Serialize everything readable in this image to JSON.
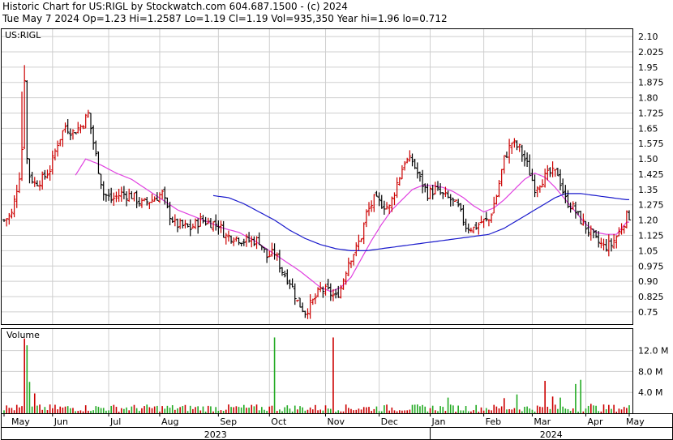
{
  "header": {
    "line1": "Historic Chart for US:RIGL by Stockwatch.com 604.687.1500 - (c) 2024",
    "line2": "Tue May  7 2024   Op=1.23  Hi=1.2587  Lo=1.19  Cl=1.19  Vol=935,350  Year hi=1.96  lo=0.712"
  },
  "chart_data": {
    "type": "candlestick",
    "symbol_label": "US:RIGL",
    "price_axis": {
      "ticks": [
        "2.10",
        "2.025",
        "1.95",
        "1.875",
        "1.80",
        "1.725",
        "1.65",
        "1.575",
        "1.50",
        "1.425",
        "1.35",
        "1.275",
        "1.20",
        "1.125",
        "1.05",
        "0.975",
        "0.90",
        "0.825",
        "0.75"
      ],
      "tick_values": [
        2.1,
        2.025,
        1.95,
        1.875,
        1.8,
        1.725,
        1.65,
        1.575,
        1.5,
        1.425,
        1.35,
        1.275,
        1.2,
        1.125,
        1.05,
        0.975,
        0.9,
        0.825,
        0.75
      ],
      "range": [
        0.69,
        2.14
      ]
    },
    "volume_panel": {
      "label": "Volume",
      "ticks": [
        "12.0 M",
        "8.0 M",
        "4.0 M"
      ],
      "tick_values": [
        12.0,
        8.0,
        4.0
      ],
      "range": [
        0,
        15.5
      ]
    },
    "x_axis": {
      "months": [
        "May",
        "Jun",
        "Jul",
        "Aug",
        "Sep",
        "Oct",
        "Nov",
        "Dec",
        "Jan",
        "Feb",
        "Mar",
        "Apr",
        "May"
      ],
      "years": [
        "2023",
        "2024"
      ]
    },
    "price_anchors": [
      [
        0,
        1.2
      ],
      [
        3,
        1.23
      ],
      [
        6,
        1.42
      ],
      [
        7,
        1.55
      ],
      [
        8,
        1.9
      ],
      [
        9,
        1.5
      ],
      [
        10,
        1.42
      ],
      [
        12,
        1.38
      ],
      [
        15,
        1.4
      ],
      [
        18,
        1.45
      ],
      [
        21,
        1.58
      ],
      [
        24,
        1.66
      ],
      [
        27,
        1.63
      ],
      [
        30,
        1.66
      ],
      [
        33,
        1.72
      ],
      [
        35,
        1.58
      ],
      [
        37,
        1.45
      ],
      [
        39,
        1.33
      ],
      [
        42,
        1.3
      ],
      [
        46,
        1.33
      ],
      [
        50,
        1.32
      ],
      [
        54,
        1.28
      ],
      [
        58,
        1.3
      ],
      [
        62,
        1.33
      ],
      [
        64,
        1.25
      ],
      [
        67,
        1.18
      ],
      [
        70,
        1.17
      ],
      [
        73,
        1.16
      ],
      [
        77,
        1.2
      ],
      [
        80,
        1.19
      ],
      [
        84,
        1.18
      ],
      [
        87,
        1.12
      ],
      [
        90,
        1.12
      ],
      [
        94,
        1.1
      ],
      [
        97,
        1.1
      ],
      [
        100,
        1.1
      ],
      [
        103,
        1.02
      ],
      [
        106,
        1.04
      ],
      [
        109,
        0.95
      ],
      [
        112,
        0.9
      ],
      [
        115,
        0.8
      ],
      [
        118,
        0.75
      ],
      [
        121,
        0.8
      ],
      [
        124,
        0.86
      ],
      [
        127,
        0.85
      ],
      [
        130,
        0.82
      ],
      [
        132,
        0.87
      ],
      [
        135,
        1.0
      ],
      [
        138,
        1.06
      ],
      [
        140,
        1.12
      ],
      [
        142,
        1.23
      ],
      [
        145,
        1.3
      ],
      [
        148,
        1.28
      ],
      [
        151,
        1.26
      ],
      [
        154,
        1.38
      ],
      [
        157,
        1.49
      ],
      [
        160,
        1.49
      ],
      [
        163,
        1.4
      ],
      [
        166,
        1.33
      ],
      [
        169,
        1.35
      ],
      [
        172,
        1.32
      ],
      [
        175,
        1.3
      ],
      [
        178,
        1.26
      ],
      [
        181,
        1.17
      ],
      [
        184,
        1.16
      ],
      [
        187,
        1.19
      ],
      [
        190,
        1.2
      ],
      [
        193,
        1.32
      ],
      [
        196,
        1.5
      ],
      [
        199,
        1.58
      ],
      [
        202,
        1.55
      ],
      [
        205,
        1.47
      ],
      [
        208,
        1.36
      ],
      [
        211,
        1.4
      ],
      [
        214,
        1.43
      ],
      [
        217,
        1.43
      ],
      [
        220,
        1.3
      ],
      [
        223,
        1.26
      ],
      [
        226,
        1.2
      ],
      [
        229,
        1.15
      ],
      [
        232,
        1.1
      ],
      [
        235,
        1.07
      ],
      [
        238,
        1.08
      ],
      [
        241,
        1.14
      ],
      [
        244,
        1.22
      ]
    ],
    "volume_spikes": [
      [
        8,
        14.3
      ],
      [
        9,
        13.0
      ],
      [
        10,
        6.0
      ],
      [
        12,
        3.8
      ],
      [
        106,
        14.5
      ],
      [
        129,
        14.5
      ],
      [
        174,
        3.0
      ],
      [
        196,
        2.9
      ],
      [
        201,
        3.6
      ],
      [
        212,
        6.2
      ],
      [
        215,
        3.2
      ],
      [
        218,
        3.0
      ],
      [
        224,
        5.6
      ],
      [
        226,
        6.4
      ],
      [
        230,
        1.8
      ]
    ],
    "series": [
      {
        "name": "50-day moving average",
        "color": "#e040e0",
        "start_index": 28,
        "anchors": [
          [
            28,
            1.42
          ],
          [
            32,
            1.5
          ],
          [
            38,
            1.47
          ],
          [
            44,
            1.43
          ],
          [
            50,
            1.4
          ],
          [
            56,
            1.35
          ],
          [
            62,
            1.3
          ],
          [
            68,
            1.25
          ],
          [
            74,
            1.22
          ],
          [
            80,
            1.19
          ],
          [
            86,
            1.16
          ],
          [
            92,
            1.14
          ],
          [
            98,
            1.1
          ],
          [
            104,
            1.05
          ],
          [
            110,
            1.0
          ],
          [
            116,
            0.95
          ],
          [
            120,
            0.91
          ],
          [
            124,
            0.87
          ],
          [
            128,
            0.85
          ],
          [
            132,
            0.87
          ],
          [
            136,
            0.92
          ],
          [
            140,
            1.01
          ],
          [
            144,
            1.1
          ],
          [
            148,
            1.18
          ],
          [
            152,
            1.25
          ],
          [
            156,
            1.3
          ],
          [
            160,
            1.35
          ],
          [
            164,
            1.37
          ],
          [
            168,
            1.37
          ],
          [
            172,
            1.36
          ],
          [
            176,
            1.34
          ],
          [
            180,
            1.31
          ],
          [
            184,
            1.27
          ],
          [
            188,
            1.24
          ],
          [
            192,
            1.26
          ],
          [
            196,
            1.3
          ],
          [
            200,
            1.35
          ],
          [
            204,
            1.4
          ],
          [
            208,
            1.43
          ],
          [
            212,
            1.41
          ],
          [
            216,
            1.36
          ],
          [
            220,
            1.3
          ],
          [
            224,
            1.24
          ],
          [
            228,
            1.18
          ],
          [
            232,
            1.14
          ],
          [
            236,
            1.13
          ],
          [
            240,
            1.13
          ],
          [
            244,
            1.19
          ]
        ]
      },
      {
        "name": "200-day moving average",
        "color": "#1a1acc",
        "start_index": 82,
        "anchors": [
          [
            82,
            1.32
          ],
          [
            88,
            1.31
          ],
          [
            94,
            1.28
          ],
          [
            100,
            1.24
          ],
          [
            106,
            1.2
          ],
          [
            112,
            1.15
          ],
          [
            118,
            1.11
          ],
          [
            124,
            1.08
          ],
          [
            130,
            1.06
          ],
          [
            136,
            1.05
          ],
          [
            142,
            1.05
          ],
          [
            148,
            1.06
          ],
          [
            154,
            1.07
          ],
          [
            160,
            1.08
          ],
          [
            166,
            1.09
          ],
          [
            172,
            1.1
          ],
          [
            178,
            1.11
          ],
          [
            184,
            1.12
          ],
          [
            190,
            1.13
          ],
          [
            196,
            1.16
          ],
          [
            200,
            1.19
          ],
          [
            204,
            1.22
          ],
          [
            208,
            1.25
          ],
          [
            212,
            1.28
          ],
          [
            216,
            1.31
          ],
          [
            220,
            1.33
          ],
          [
            226,
            1.33
          ],
          [
            232,
            1.32
          ],
          [
            238,
            1.31
          ],
          [
            244,
            1.3
          ]
        ]
      }
    ],
    "colors": {
      "up_candle": "#cc0000",
      "down_candle": "#000000",
      "volume_up": "#cc0000",
      "volume_down": "#22aa22",
      "grid": "#cfcfcf",
      "frame": "#000000"
    }
  }
}
